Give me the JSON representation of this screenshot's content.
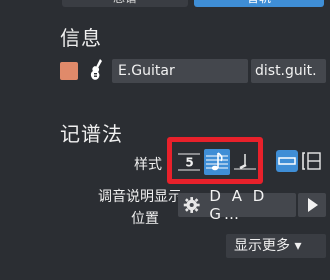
{
  "tabs": {
    "left_label": "总谱",
    "right_label": "音轨"
  },
  "info_section": {
    "title": "信息",
    "track_color": "#e08a6a",
    "instrument_icon": "electric-guitar-icon",
    "name_value": "E.Guitar",
    "abbr_value": "dist.guit."
  },
  "notation_section": {
    "title": "记谱法",
    "style_label": "样式",
    "buttons": [
      {
        "name": "tab-notation",
        "icon": "tab-5-icon",
        "active": false
      },
      {
        "name": "standard-notation",
        "icon": "staff-note-icon",
        "active": true
      },
      {
        "name": "slash-notation",
        "icon": "slash-note-icon",
        "active": false
      }
    ],
    "highlight_color": "#e8212b",
    "tuning_label_line1": "调音说明显示",
    "tuning_label_line2": "位置",
    "tuning_value": "D A D G…",
    "show_more_label": "显示更多 ▾"
  }
}
